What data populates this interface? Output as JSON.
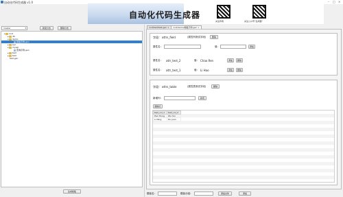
{
  "window": {
    "title": "自动化代码生成器 v1.0",
    "controls": [
      "–",
      "□",
      "×"
    ]
  },
  "banner": {
    "title": "自动化代码生成器",
    "qr_captions": [
      "关注作者",
      "关注公众号“生成器”"
    ]
  },
  "left": {
    "select_value": "master",
    "new_btn": "新建分支",
    "delete_btn": "删除分支",
    "tree": [
      {
        "label": "root",
        "type": "folder",
        "level": 0,
        "expanded": true
      },
      {
        "label": "db",
        "type": "folder",
        "level": 1,
        "expanded": false
      },
      {
        "label": "demo",
        "type": "folder",
        "level": 1,
        "expanded": true
      },
      {
        "label": "模板示例.gen",
        "type": "file",
        "level": 2,
        "selected": true
      },
      {
        "label": "sys",
        "type": "folder",
        "level": 1,
        "expanded": false
      },
      {
        "label": "mysql",
        "type": "folder",
        "level": 1,
        "expanded": true
      },
      {
        "label": "查询示例.gen",
        "type": "file",
        "level": 2
      },
      {
        "label": "test",
        "type": "folder",
        "level": 1,
        "expanded": false
      },
      {
        "label": "test",
        "type": "folder",
        "level": 1,
        "expanded": false
      },
      {
        "label": "test.gen",
        "type": "file",
        "level": 1
      }
    ],
    "generate_btn": "生成模板"
  },
  "tabs": [
    {
      "label": "root/test/test.gen ×",
      "active": false
    },
    {
      "label": "root/demo/模板示例.gen ×",
      "active": true
    }
  ],
  "field_section": {
    "field_label": "字段：",
    "field_name": "attrs_field",
    "field_desc": "(属性列测试字段)",
    "delete_btn": "删除",
    "attr_name_label": "属性名：",
    "value_label": "值：",
    "add_btn": "添加",
    "rows": [
      {
        "attr": "attr_test_2",
        "value_label": "值：",
        "value": "Chao Ren",
        "add": "添加",
        "del": "删除"
      },
      {
        "attr": "attr_test_1",
        "value_label": "值：",
        "value": "Li Hao",
        "add": "添加",
        "del": "删除"
      }
    ]
  },
  "table_section": {
    "field_label": "字段：",
    "field_name": "attrs_table",
    "field_desc": "(属性表测试字段)",
    "delete_btn": "删除",
    "new_col_label": "新增列：",
    "new_col_btn": "新增",
    "delete_row_btn": "删除行",
    "columns": [
      "test_col_1",
      "test_col_2"
    ],
    "rows": [
      [
        "Han Hong",
        "Wu Yun"
      ],
      [
        "Li Ning",
        "Du Juan"
      ]
    ]
  },
  "bottom_bar": {
    "template_name_label": "模板名：",
    "template_group_label": "模板分组：",
    "add_file_btn": "添加文件",
    "add_btn": "添加"
  }
}
